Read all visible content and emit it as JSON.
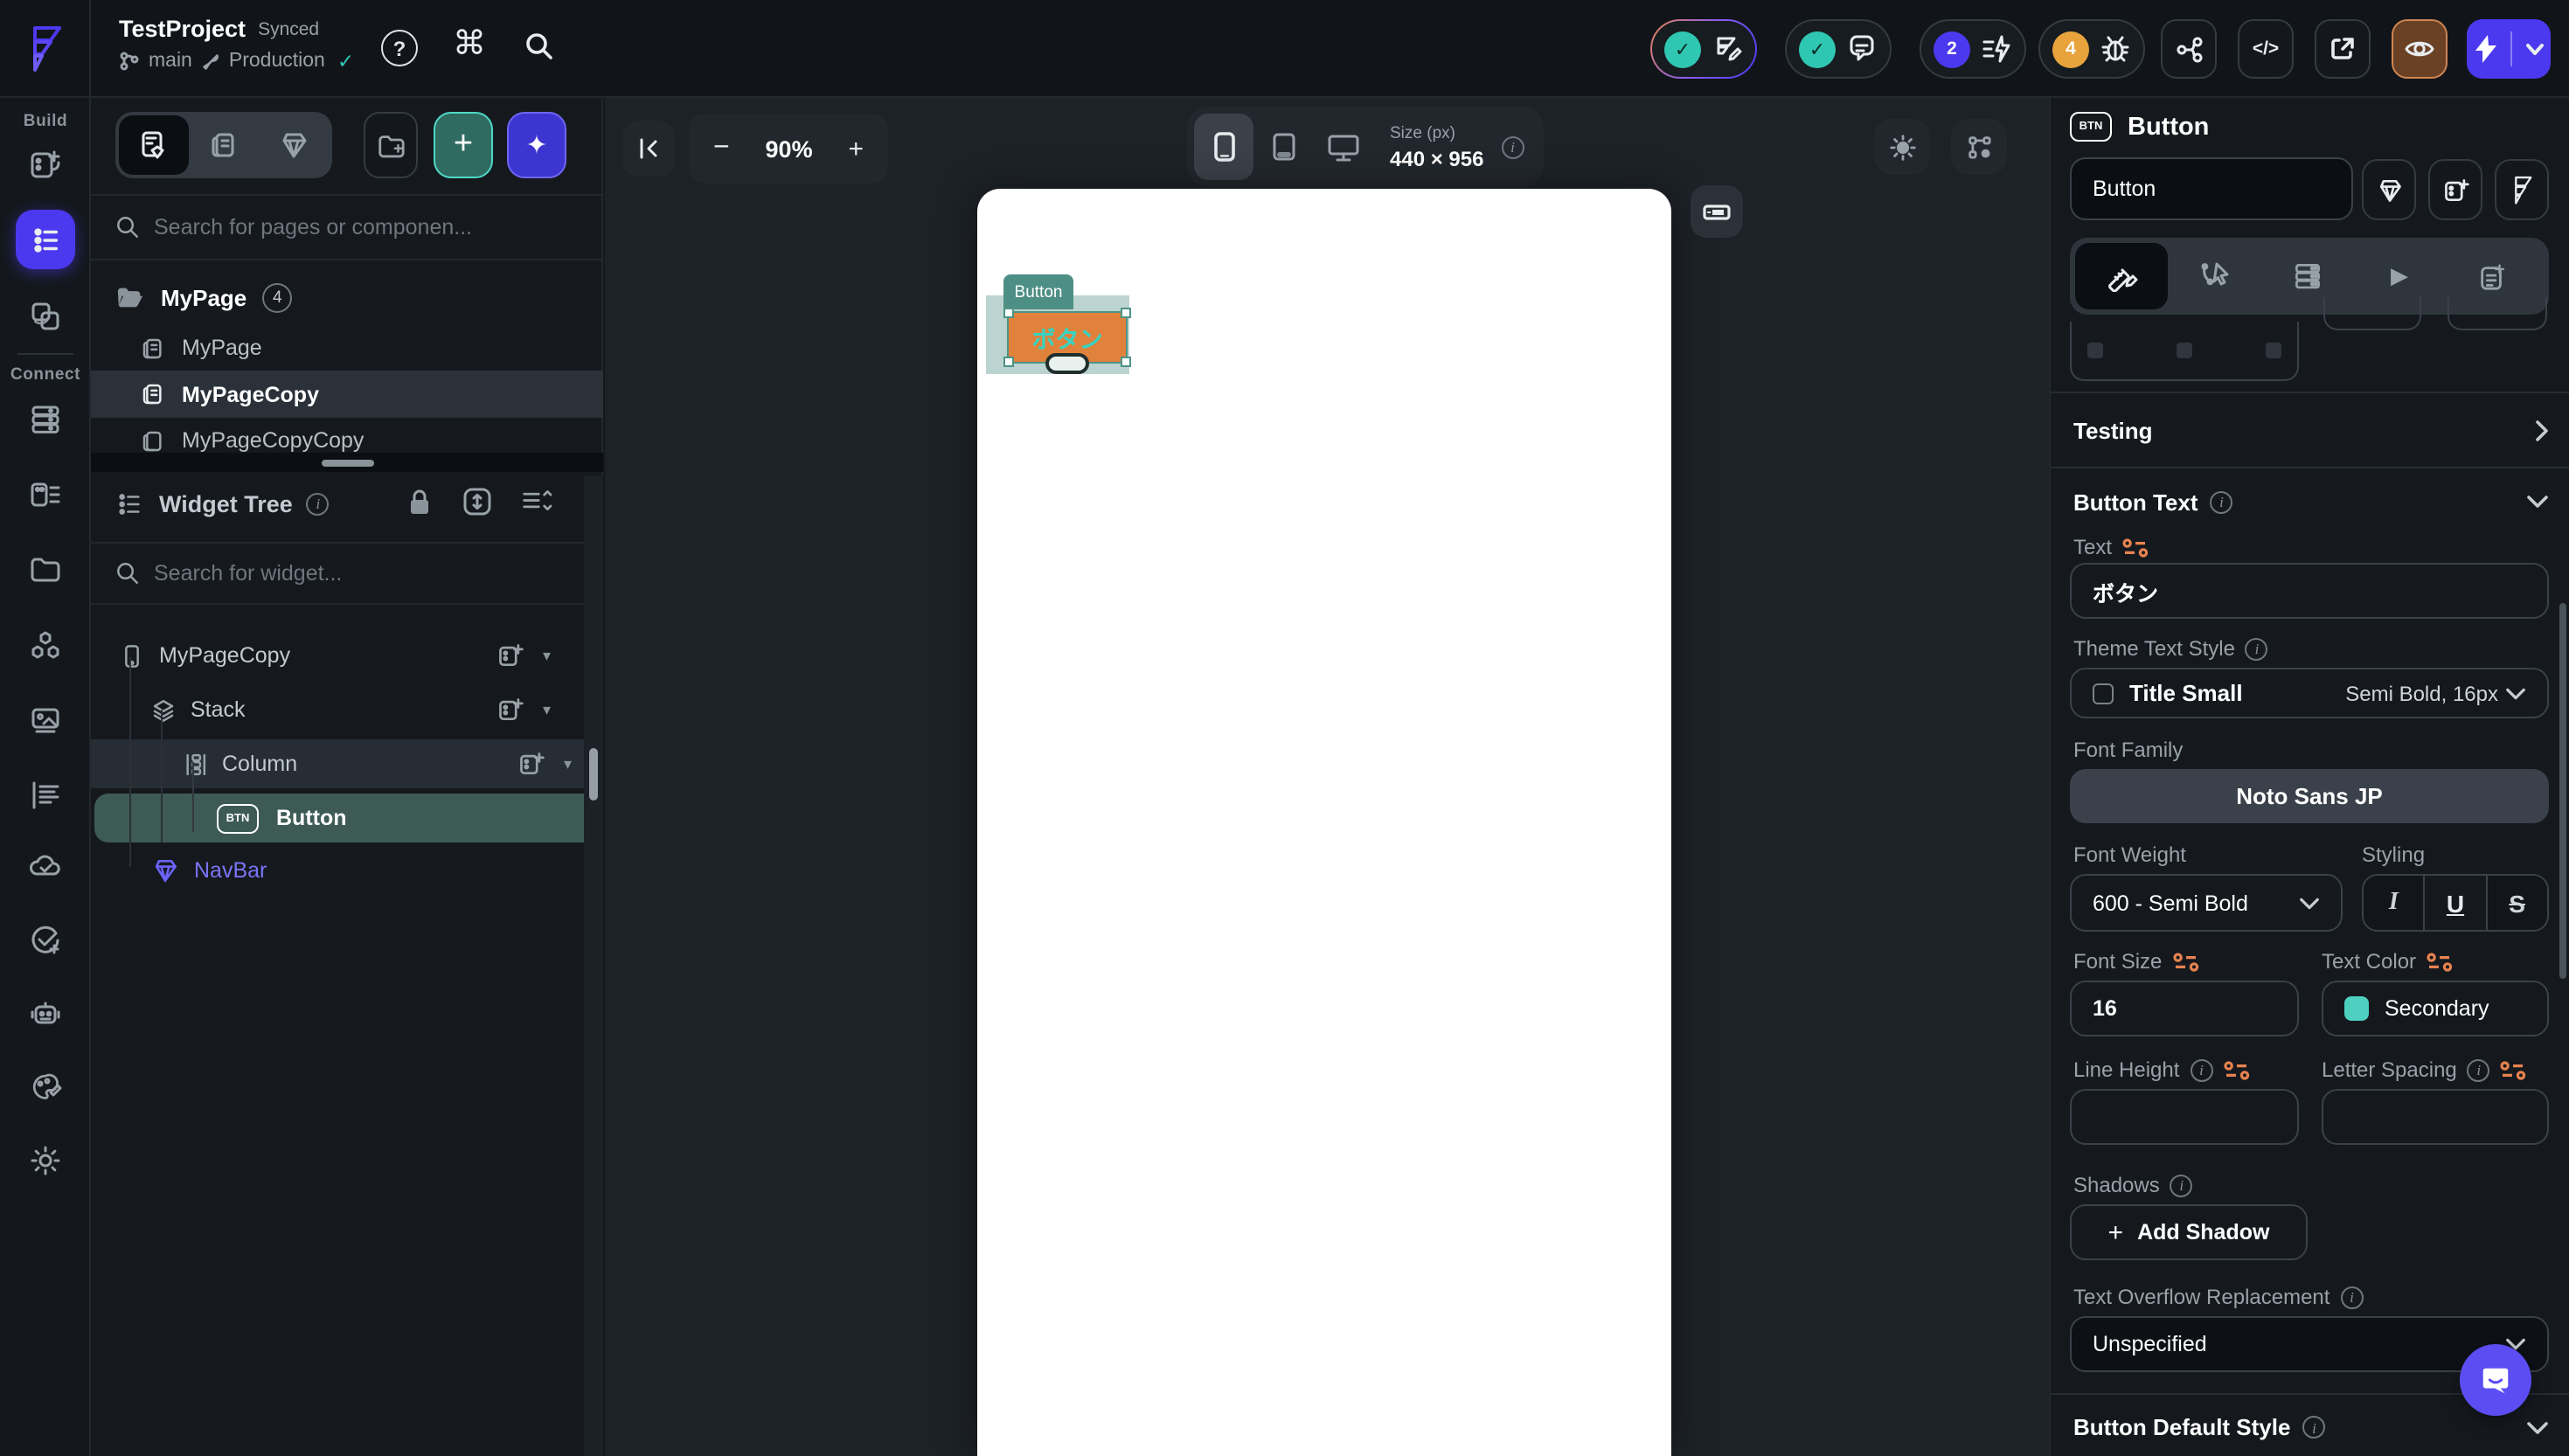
{
  "glyphs": {
    "check": "✓",
    "command": "⌘",
    "question": "?",
    "minus": "−",
    "plus": "+",
    "caret_down": "▾",
    "chevron_right": "›",
    "code": "</>",
    "play": "▶",
    "sparkles": "✦",
    "btn_badge": "BTN"
  },
  "header": {
    "project_name": "TestProject",
    "sync_status": "Synced",
    "branch": "main",
    "environment": "Production",
    "review_count": "2",
    "issue_count": "4"
  },
  "rail": {
    "build_label": "Build",
    "connect_label": "Connect"
  },
  "pages_panel": {
    "search_placeholder": "Search for pages or componen...",
    "folder": {
      "name": "MyPage",
      "count": "4"
    },
    "items": [
      {
        "label": "MyPage"
      },
      {
        "label": "MyPageCopy"
      },
      {
        "label": "MyPageCopyCopy"
      }
    ]
  },
  "widget_tree": {
    "title": "Widget Tree",
    "search_placeholder": "Search for widget...",
    "nodes": [
      {
        "label": "MyPageCopy"
      },
      {
        "label": "Stack"
      },
      {
        "label": "Column"
      },
      {
        "label": "Button"
      },
      {
        "label": "NavBar"
      }
    ]
  },
  "canvas": {
    "zoom_level": "90%",
    "size_label": "Size (px)",
    "size_value": "440 × 956",
    "widget_tag": "Button",
    "button_text": "ボタン"
  },
  "inspector": {
    "widget_type": "Button",
    "name_value": "Button",
    "sections": {
      "testing": "Testing",
      "button_text": "Button Text",
      "button_default_style": "Button Default Style"
    },
    "fields": {
      "text_label": "Text",
      "text_value": "ボタン",
      "theme_text_style_label": "Theme Text Style",
      "theme_style_name": "Title Small",
      "theme_style_desc": "Semi Bold, 16px",
      "font_family_label": "Font Family",
      "font_family_value": "Noto Sans JP",
      "font_weight_label": "Font Weight",
      "font_weight_value": "600 - Semi Bold",
      "styling_label": "Styling",
      "italic": "I",
      "underline": "U",
      "strikethrough": "S",
      "font_size_label": "Font Size",
      "font_size_value": "16",
      "text_color_label": "Text Color",
      "text_color_value": "Secondary",
      "line_height_label": "Line Height",
      "letter_spacing_label": "Letter Spacing",
      "shadows_label": "Shadows",
      "add_shadow_label": "Add Shadow",
      "text_overflow_label": "Text Overflow Replacement",
      "text_overflow_value": "Unspecified"
    }
  },
  "colors": {
    "accent": "#4b39ef",
    "teal": "#39d2c0",
    "selection": "#4d9387",
    "canvas_button": "#e0823c",
    "badge_blue": "#4b39ef",
    "badge_orange": "#e8a33d",
    "secondary_swatch": "#4dd0c0"
  }
}
